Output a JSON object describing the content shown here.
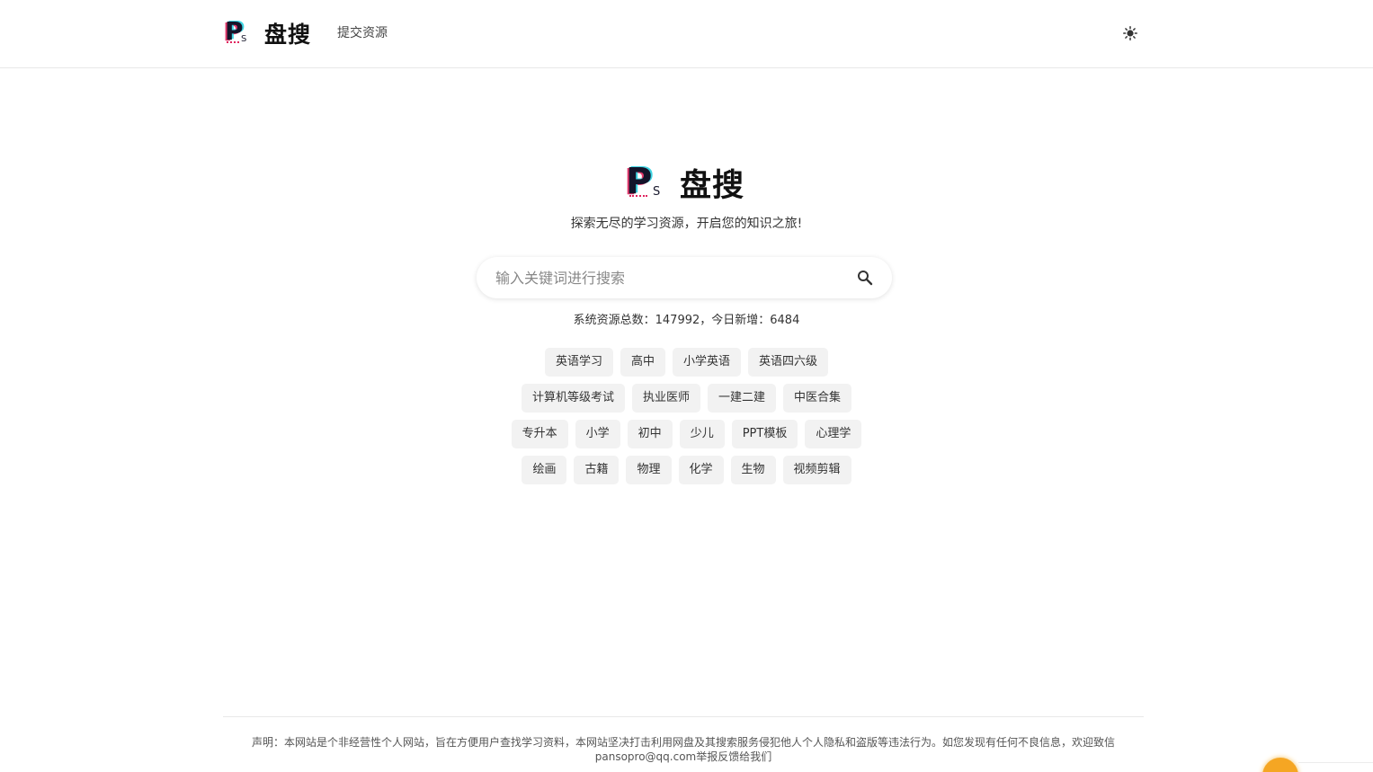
{
  "header": {
    "logo_letter": "P",
    "logo_sub": "S",
    "brand": "盘搜",
    "nav_link": "提交资源",
    "theme_icon": "sun-icon"
  },
  "hero": {
    "logo_letter": "P",
    "logo_sub": "S",
    "brand": "盘搜",
    "tagline": "探索无尽的学习资源，开启您的知识之旅!"
  },
  "search": {
    "placeholder": "输入关键词进行搜索",
    "value": "",
    "icon": "search-icon"
  },
  "stats": {
    "text": "系统资源总数：147992，今日新增：6484"
  },
  "tags": {
    "rows": [
      [
        "英语学习",
        "高中",
        "小学英语",
        "英语四六级"
      ],
      [
        "计算机等级考试",
        "执业医师",
        "一建二建",
        "中医合集"
      ],
      [
        "专升本",
        "小学",
        "初中",
        "少儿",
        "PPT模板",
        "心理学"
      ],
      [
        "绘画",
        "古籍",
        "物理",
        "化学",
        "生物",
        "视频剪辑"
      ]
    ]
  },
  "footer": {
    "disclaimer": "声明：本网站是个非经营性个人网站，旨在方便用户查找学习资料，本网站坚决打击利用网盘及其搜索服务侵犯他人个人隐私和盗版等违法行为。如您发现有任何不良信息，欢迎致信pansopro@qq.com举报反馈给我们"
  },
  "colors": {
    "accent_red": "#e0245e",
    "accent_cyan": "#2ad1e0",
    "tag_bg": "#f2f2f2"
  }
}
